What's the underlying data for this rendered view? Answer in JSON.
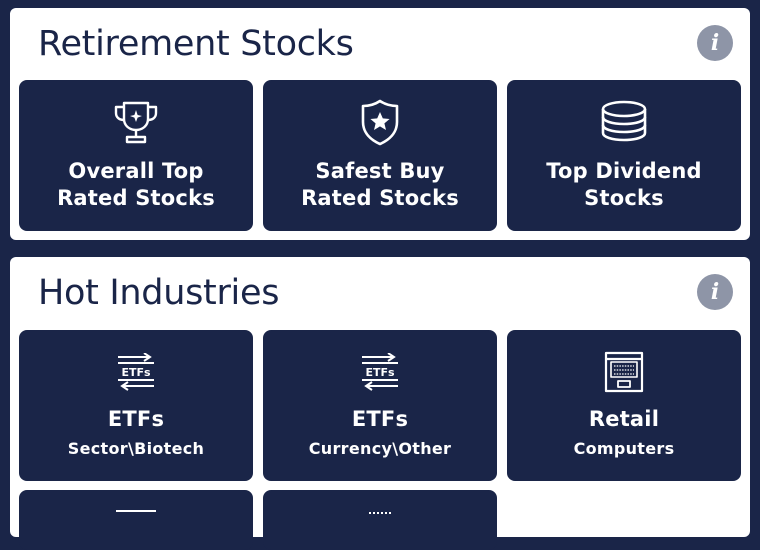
{
  "sections": [
    {
      "title": "Retirement Stocks",
      "info": "i",
      "tiles": [
        {
          "line1": "Overall Top",
          "line2": "Rated Stocks",
          "icon": "trophy-icon"
        },
        {
          "line1": "Safest Buy",
          "line2": "Rated Stocks",
          "icon": "shield-star-icon"
        },
        {
          "line1": "Top Dividend",
          "line2": "Stocks",
          "icon": "coin-stack-icon"
        }
      ]
    },
    {
      "title": "Hot Industries",
      "info": "i",
      "tiles": [
        {
          "title": "ETFs",
          "sub": "Sector\\Biotech",
          "icon": "etf-exchange-icon",
          "icon_text": "ETFs"
        },
        {
          "title": "ETFs",
          "sub": "Currency\\Other",
          "icon": "etf-exchange-icon",
          "icon_text": "ETFs"
        },
        {
          "title": "Retail",
          "sub": "Computers",
          "icon": "laptop-icon"
        }
      ]
    }
  ],
  "colors": {
    "navy": "#1a2548",
    "info_gray": "#8e95a7",
    "panel": "#ffffff"
  }
}
